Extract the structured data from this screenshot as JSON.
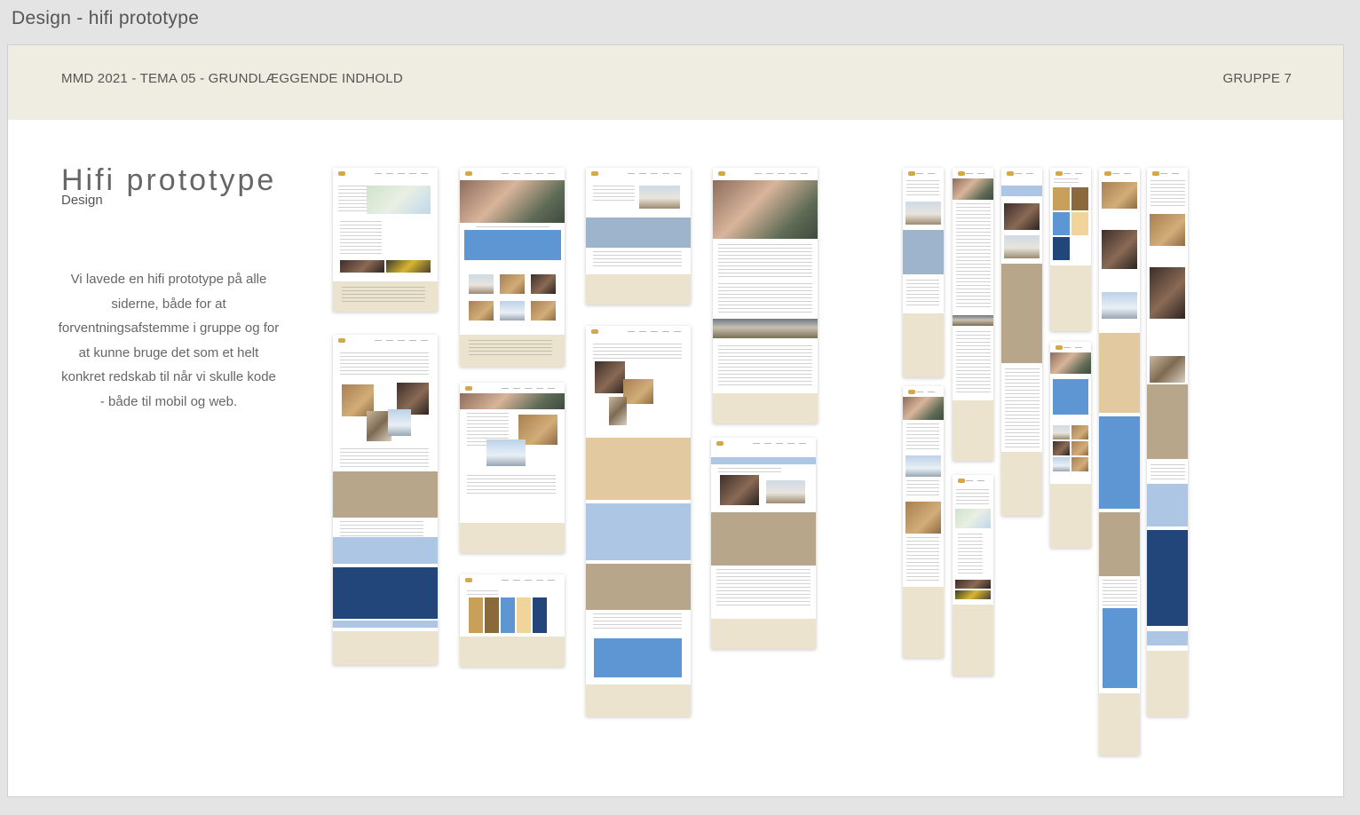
{
  "window": {
    "title": "Design - hifi prototype"
  },
  "header": {
    "left": "MMD 2021 - TEMA 05 - GRUNDLÆGGENDE INDHOLD",
    "right": "GRUPPE 7"
  },
  "content": {
    "title": "Hifi prototype",
    "subtitle": "Design",
    "description": "Vi lavede en hifi prototype på alle siderne, både for at forventningsafstemme i gruppe og for at kunne bruge det som et helt konkret redskab til når vi skulle kode - både til mobil og web."
  },
  "colors": {
    "header_band": "#efece2",
    "beige": "#ebe3cd",
    "tan": "#b7a68a",
    "light_blue": "#adc6e4",
    "blue": "#5e95d3",
    "dark_blue": "#22467a"
  }
}
